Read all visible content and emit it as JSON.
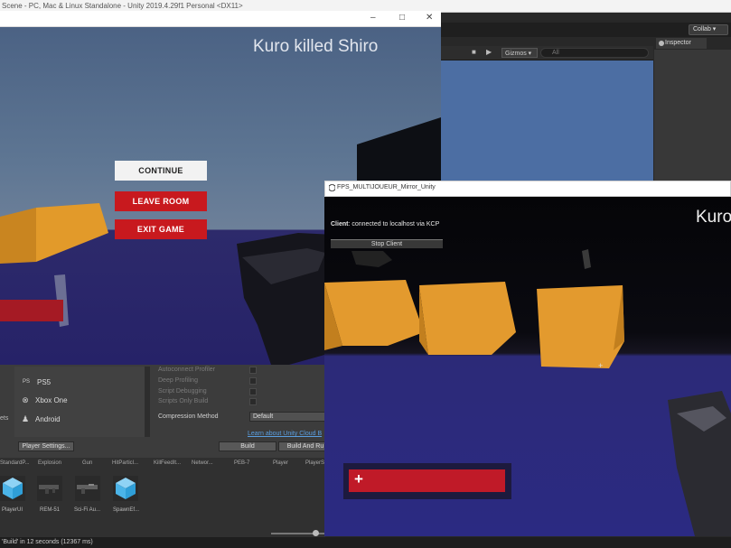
{
  "editor": {
    "title": "Scene - PC, Mac & Linux Standalone - Unity 2019.4.29f1 Personal <DX11>",
    "collab_label": "Collab",
    "gizmos_label": "Gizmos",
    "search_placeholder": "All",
    "inspector_tab": "Inspector",
    "status_text": "'Build' in 12 seconds (12367 ms)"
  },
  "build_settings": {
    "platforms": [
      {
        "label": "PS5",
        "icon": "ps5-icon"
      },
      {
        "label": "Xbox One",
        "icon": "xbox-icon"
      },
      {
        "label": "Android",
        "icon": "android-icon"
      }
    ],
    "options": [
      "Autoconnect Profiler",
      "Deep Profiling",
      "Script Debugging",
      "Scripts Only Build"
    ],
    "compression_label": "Compression Method",
    "compression_value": "Default",
    "cloud_link": "Learn about Unity Cloud B",
    "player_settings_button": "Player Settings...",
    "build_button": "Build",
    "build_and_run_button": "Build And Ru",
    "side_label": "ets"
  },
  "assets": {
    "labels": [
      "StandardP...",
      "Explosion",
      "Gun",
      "HitParticl...",
      "KillFeedIt...",
      "Networ...",
      "PEB-7",
      "Player",
      "PlayerS..."
    ],
    "items": [
      {
        "name": "PlayerUI",
        "icon": "prefab-cube-icon"
      },
      {
        "name": "REM-51",
        "icon": "gun-icon"
      },
      {
        "name": "Sci-Fi Au...",
        "icon": "gun-icon"
      },
      {
        "name": "SpawnEf...",
        "icon": "prefab-cube-icon"
      }
    ]
  },
  "game1": {
    "kill_feed": "Kuro killed Shiro",
    "continue_label": "CONTINUE",
    "leave_label": "LEAVE ROOM",
    "exit_label": "EXIT GAME",
    "minimize": "–",
    "maximize": "□",
    "close": "✕"
  },
  "game2": {
    "window_title": "FPS_MULTIJOUEUR_Mirror_Unity",
    "client_label": "Client",
    "client_status": ": connected to localhost via KCP",
    "stop_client_label": "Stop Client",
    "kill_feed": "Kuro",
    "health_icon": "+",
    "crosshair": "+"
  },
  "colors": {
    "menu_red": "#c8191e",
    "health_red": "#c01a28",
    "crate_orange": "#e39a2e",
    "floor_blue": "#2b2a82"
  }
}
